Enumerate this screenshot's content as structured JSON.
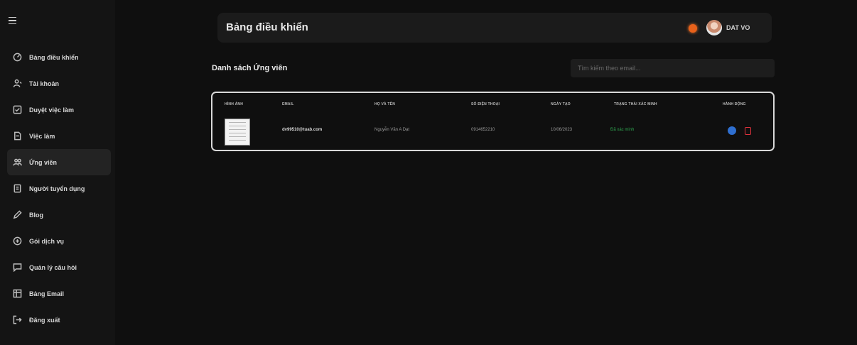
{
  "sidebar": {
    "items": [
      {
        "label": "Bảng điều khiển",
        "icon": "dashboard-icon",
        "active": false
      },
      {
        "label": "Tài khoản",
        "icon": "user-icon",
        "active": false
      },
      {
        "label": "Duyệt việc làm",
        "icon": "checklist-icon",
        "active": false
      },
      {
        "label": "Việc làm",
        "icon": "briefcase-icon",
        "active": false
      },
      {
        "label": "Ứng viên",
        "icon": "users-icon",
        "active": true
      },
      {
        "label": "Người tuyển dụng",
        "icon": "recruiter-icon",
        "active": false
      },
      {
        "label": "Blog",
        "icon": "pen-icon",
        "active": false
      },
      {
        "label": "Gói dịch vụ",
        "icon": "package-icon",
        "active": false
      },
      {
        "label": "Quản lý câu hỏi",
        "icon": "chat-icon",
        "active": false
      },
      {
        "label": "Bảng Email",
        "icon": "email-table-icon",
        "active": false
      },
      {
        "label": "Đăng xuất",
        "icon": "logout-icon",
        "active": false
      }
    ]
  },
  "header": {
    "title": "Bảng điều khiển",
    "username": "DAT VO"
  },
  "main": {
    "section_title": "Danh sách Ứng viên",
    "search_placeholder": "Tìm kiếm theo email..."
  },
  "table": {
    "columns": [
      "HÌNH ẢNH",
      "EMAIL",
      "HỌ VÀ TÊN",
      "SỐ ĐIỆN THOẠI",
      "NGÀY TẠO",
      "TRẠNG THÁI XÁC MINH",
      "HÀNH ĐỘNG"
    ],
    "rows": [
      {
        "email": "dv99510@tuab.com",
        "name": "Nguyễn Văn A Dạt",
        "phone": "0914652210",
        "created": "10/06/2023",
        "status": "Đã xác minh"
      }
    ]
  },
  "colors": {
    "background": "#0f0f0f",
    "sidebar": "#141414",
    "status_verified": "#2ea44f",
    "action_view": "#2f6fd0",
    "action_delete": "#e0323c",
    "notification": "#e8611a"
  }
}
